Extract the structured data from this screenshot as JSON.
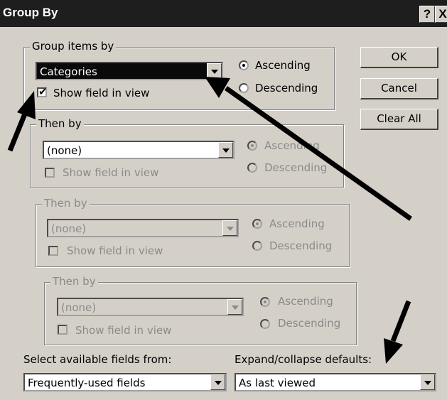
{
  "window": {
    "title": "Group By",
    "help_label": "?",
    "close_label": "X"
  },
  "groups": [
    {
      "legend": "Group items by",
      "field": "Categories",
      "show_field_label": "Show field in view",
      "show_field_checked": true,
      "ascending_label": "Ascending",
      "descending_label": "Descending",
      "order": "ascending",
      "enabled": true
    },
    {
      "legend": "Then by",
      "field": "(none)",
      "show_field_label": "Show field in view",
      "show_field_checked": false,
      "ascending_label": "Ascending",
      "descending_label": "Descending",
      "order": "ascending",
      "enabled": true
    },
    {
      "legend": "Then by",
      "field": "(none)",
      "show_field_label": "Show field in view",
      "show_field_checked": false,
      "ascending_label": "Ascending",
      "descending_label": "Descending",
      "order": "ascending",
      "enabled": false
    },
    {
      "legend": "Then by",
      "field": "(none)",
      "show_field_label": "Show field in view",
      "show_field_checked": false,
      "ascending_label": "Ascending",
      "descending_label": "Descending",
      "order": "ascending",
      "enabled": false
    }
  ],
  "buttons": {
    "ok": "OK",
    "cancel": "Cancel",
    "clear_all": "Clear All"
  },
  "select_fields": {
    "label": "Select available fields from:",
    "value": "Frequently-used fields"
  },
  "expand_defaults": {
    "label": "Expand/collapse defaults:",
    "value": "As last viewed"
  },
  "checkmark": "✔",
  "annotation_color": "#000000"
}
